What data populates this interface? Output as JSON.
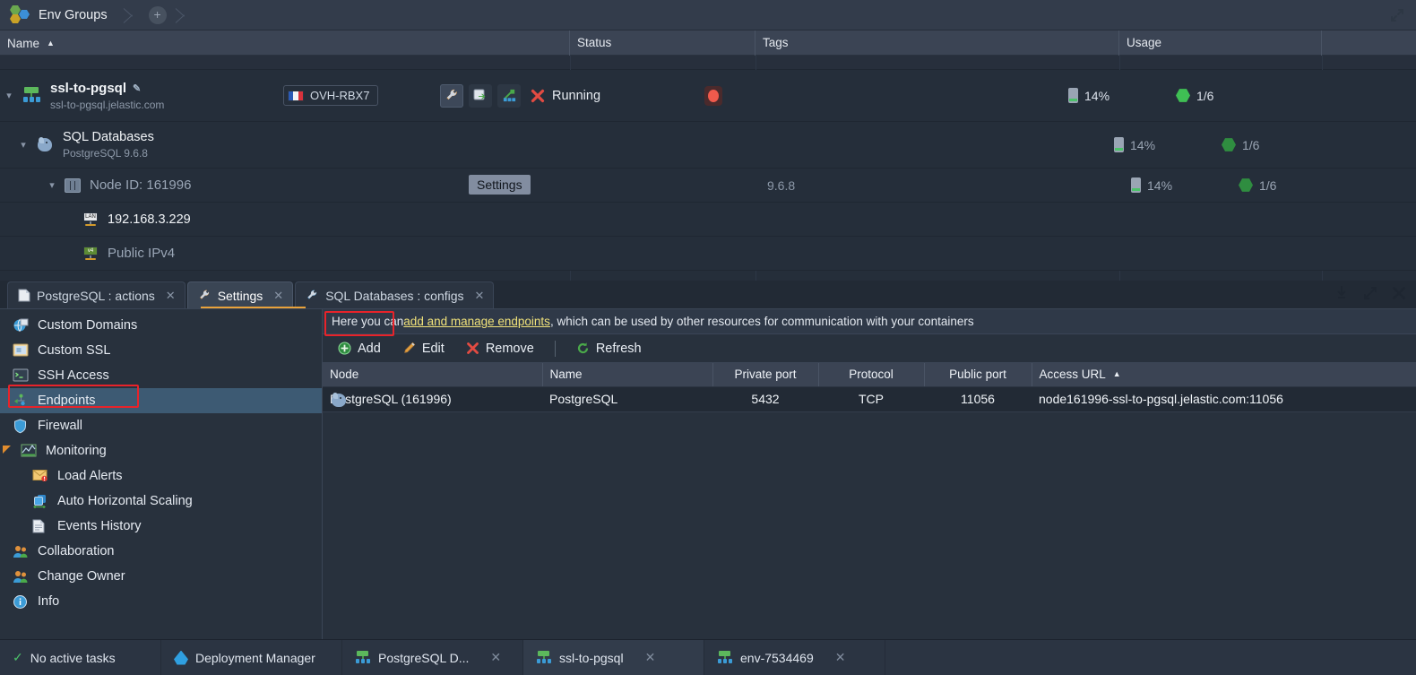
{
  "breadcrumb": {
    "label": "Env Groups",
    "add_label": "+",
    "icon": "env-groups-hex-icon"
  },
  "env_grid": {
    "columns": [
      {
        "key": "name",
        "label": "Name",
        "sorted": "asc",
        "caret": "▲"
      },
      {
        "key": "status",
        "label": "Status"
      },
      {
        "key": "tags",
        "label": "Tags"
      },
      {
        "key": "usage",
        "label": "Usage"
      },
      {
        "key": "extra",
        "label": ""
      }
    ],
    "rows": [
      {
        "type": "environment",
        "name": "ssl-to-pgsql",
        "domain": "ssl-to-pgsql.jelastic.com",
        "region": "OVH-RBX7",
        "region_flag": "flag-fr",
        "status": "Running",
        "has_tag_dot": true,
        "ram": "14%",
        "cloudlets": "1/6",
        "actions": [
          "settings-wrench-icon",
          "clone-icon",
          "topology-icon",
          "delete-icon"
        ]
      },
      {
        "type": "node-group",
        "name": "SQL Databases",
        "sub": "PostgreSQL 9.6.8",
        "ram": "14%",
        "cloudlets": "1/6"
      },
      {
        "type": "node",
        "name": "Node ID: 161996",
        "tag": "9.6.8",
        "ram": "14%",
        "cloudlets": "1/6"
      },
      {
        "type": "ip",
        "name": "192.168.3.229",
        "icon": "lan-icon"
      },
      {
        "type": "ip",
        "name": "Public IPv4",
        "icon": "ipv4-icon",
        "dim": true
      }
    ],
    "tooltip": "Settings"
  },
  "panel": {
    "tabs": [
      {
        "label": "PostgreSQL : actions",
        "icon": "document-icon",
        "active": false,
        "closable": true
      },
      {
        "label": "Settings",
        "icon": "wrench-icon",
        "active": true,
        "closable": true
      },
      {
        "label": "SQL Databases : configs",
        "icon": "wrench-icon",
        "active": false,
        "closable": true
      }
    ],
    "controls": [
      "minimize-icon",
      "maximize-icon",
      "close-icon"
    ]
  },
  "menu": {
    "items": [
      {
        "label": "Custom Domains",
        "icon": "globe-icon",
        "level": 0,
        "selected": false
      },
      {
        "label": "Custom SSL",
        "icon": "certificate-icon",
        "level": 0,
        "selected": false
      },
      {
        "label": "SSH Access",
        "icon": "terminal-icon",
        "level": 0,
        "selected": false
      },
      {
        "label": "Endpoints",
        "icon": "endpoints-icon",
        "level": 0,
        "selected": true
      },
      {
        "label": "Firewall",
        "icon": "shield-icon",
        "level": 0,
        "selected": false
      },
      {
        "label": "Monitoring",
        "icon": "chart-icon",
        "level": 0,
        "selected": false,
        "expanded": true
      },
      {
        "label": "Load Alerts",
        "icon": "mail-alert-icon",
        "level": 1,
        "selected": false
      },
      {
        "label": "Auto Horizontal Scaling",
        "icon": "scaling-icon",
        "level": 1,
        "selected": false
      },
      {
        "label": "Events History",
        "icon": "document-icon",
        "level": 1,
        "selected": false
      },
      {
        "label": "Collaboration",
        "icon": "users-icon",
        "level": 0,
        "selected": false
      },
      {
        "label": "Change Owner",
        "icon": "user-swap-icon",
        "level": 0,
        "selected": false
      },
      {
        "label": "Info",
        "icon": "info-icon",
        "level": 0,
        "selected": false
      }
    ]
  },
  "endpoints": {
    "banner_prefix": "Here you can ",
    "banner_link": "add and manage endpoints",
    "banner_suffix": ", which can be used by other resources for communication with your containers",
    "toolbar": [
      {
        "label": "Add",
        "icon": "plus-circle-icon"
      },
      {
        "label": "Edit",
        "icon": "pencil-icon"
      },
      {
        "label": "Remove",
        "icon": "x-icon"
      },
      {
        "label": "Refresh",
        "icon": "refresh-icon"
      }
    ],
    "columns": [
      {
        "key": "node",
        "label": "Node"
      },
      {
        "key": "name",
        "label": "Name"
      },
      {
        "key": "private_port",
        "label": "Private port"
      },
      {
        "key": "protocol",
        "label": "Protocol"
      },
      {
        "key": "public_port",
        "label": "Public port"
      },
      {
        "key": "access_url",
        "label": "Access URL",
        "sorted": "asc",
        "caret": "▲"
      }
    ],
    "rows": [
      {
        "node": "PostgreSQL (161996)",
        "name": "PostgreSQL",
        "private_port": "5432",
        "protocol": "TCP",
        "public_port": "11056",
        "access_url": "node161996-ssl-to-pgsql.jelastic.com:11056"
      }
    ]
  },
  "taskbar": {
    "status": "No active tasks",
    "items": [
      {
        "label": "Deployment Manager",
        "icon": "drop-icon",
        "closable": false,
        "active": false
      },
      {
        "label": "PostgreSQL D...",
        "icon": "env-icon",
        "closable": true,
        "active": false
      },
      {
        "label": "ssl-to-pgsql",
        "icon": "env-icon",
        "closable": true,
        "active": true
      },
      {
        "label": "env-7534469",
        "icon": "env-icon",
        "closable": true,
        "active": false
      }
    ]
  },
  "colors": {
    "accent_orange": "#e9a23b",
    "annotation_red": "#e8232a",
    "link_yellow": "#f0e27a",
    "selection_blue": "#3d5a73",
    "status_green": "#4cc26a"
  }
}
